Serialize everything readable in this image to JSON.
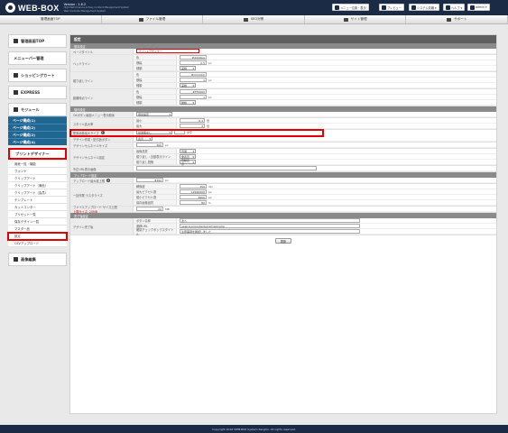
{
  "app": {
    "logo_text": "WEB-BOX",
    "version": "Version : 1.6.2",
    "tagline_1": "High Performance & Easy Content Management System",
    "tagline_2": "Web Contents Management System"
  },
  "topbar": {
    "buttons": [
      {
        "label": "メニュー位置・表示",
        "icon": "layout-icon"
      },
      {
        "label": "プレビュー",
        "icon": "monitor-icon"
      },
      {
        "label": "システム情報 ▾",
        "icon": "gear-icon"
      },
      {
        "label": "ヘルプ ▾",
        "icon": "help-icon"
      },
      {
        "label": "admin ▾",
        "icon": "user-icon"
      }
    ]
  },
  "navbar": {
    "items": [
      {
        "label": "管理画面TOP",
        "icon": "home-icon"
      },
      {
        "label": "ファイル管理",
        "icon": "image-icon"
      },
      {
        "label": "SEO対策",
        "icon": "chart-icon"
      },
      {
        "label": "サイト管理",
        "icon": "site-icon"
      },
      {
        "label": "サポート",
        "icon": "support-icon"
      }
    ]
  },
  "sidebar": {
    "top_items": [
      {
        "label": "管理画面TOP",
        "icon": "home-icon"
      },
      {
        "label": "メニューバー管理",
        "icon": ""
      },
      {
        "label": "ショッピングカート",
        "icon": "cart-icon"
      },
      {
        "label": "EXPRESS",
        "icon": "printer-icon"
      }
    ],
    "module_label": "モジュール",
    "module_icon": "gear-icon",
    "page_items": [
      "ページ構成(1)",
      "ページ構成(2)",
      "ページ構成(2)",
      "ページ構成(4)"
    ],
    "designer_label": "プリントデザイナー",
    "designer_icon": "pencil-icon",
    "sub_items": [
      "用紙一覧・機能",
      "フォント",
      "クリップアート",
      "クリップアート（満色）",
      "クリップアート（会員）",
      "テンプレート",
      "カットコンター",
      "プリセット一覧",
      "保存デザイン一覧",
      "マスター品",
      "設定",
      "CSVアップロード"
    ],
    "highlight_index": 10,
    "bottom_label": "画像編集",
    "bottom_icon": "edit-icon"
  },
  "main": {
    "title": "設定",
    "sections": [
      {
        "title": "基本設定",
        "rows": [
          {
            "label": "ページタイトル",
            "subs": [
              {
                "sub": "",
                "value": "プリントデザイナー",
                "kind": "input-red",
                "w": 70
              }
            ]
          },
          {
            "label": "ヘッドライン",
            "subs": [
              {
                "sub": "色",
                "value": "#4444AA",
                "kind": "input",
                "w": 30
              },
              {
                "sub": "横幅",
                "value": "0.5",
                "unit": "px",
                "kind": "input",
                "w": 30
              },
              {
                "sub": "種類",
                "value": "実線",
                "kind": "select",
                "w": 18
              }
            ]
          },
          {
            "label": "縦り返しライン",
            "subs": [
              {
                "sub": "色",
                "value": "#CCCCCC",
                "kind": "input",
                "w": 30
              },
              {
                "sub": "横幅",
                "value": "1",
                "unit": "px",
                "kind": "input",
                "w": 30
              },
              {
                "sub": "種類",
                "value": "実線",
                "kind": "select",
                "w": 18
              }
            ]
          },
          {
            "label": "距離時点ライン",
            "subs": [
              {
                "sub": "色",
                "value": "#FF0000",
                "kind": "input",
                "w": 30
              },
              {
                "sub": "横幅",
                "value": "1",
                "unit": "px",
                "kind": "input",
                "w": 30
              },
              {
                "sub": "種類",
                "value": "破線",
                "kind": "select",
                "w": 18
              }
            ]
          }
        ]
      },
      {
        "title": "操作設定",
        "rows": [
          {
            "label": "OKボタン画面メニュー表示順序",
            "subs": [
              {
                "sub": "",
                "value": "用途設定",
                "kind": "select",
                "w": 40
              }
            ]
          },
          {
            "label": "スタイル拡大率",
            "subs": [
              {
                "sub": "最小",
                "value": "0.1",
                "unit": "倍",
                "kind": "input",
                "w": 28
              },
              {
                "sub": "最大",
                "value": "3",
                "unit": "倍",
                "kind": "input",
                "w": 28
              }
            ]
          },
          {
            "label": "配置画像最大サイズ",
            "help": true,
            "highlight": true,
            "subs": [
              {
                "sub": "",
                "value": "最適値なし",
                "unit": "文字",
                "kind": "select",
                "w": 40,
                "extra": true
              }
            ]
          },
          {
            "label": "デザイン作成・貼付品ボタン",
            "subs": [
              {
                "sub": "",
                "value": "表示",
                "kind": "select",
                "w": 18
              }
            ]
          },
          {
            "label": "デザインサムネイルサイズ",
            "subs": [
              {
                "sub": "",
                "value": "300",
                "unit": "px",
                "kind": "input",
                "w": 30
              }
            ]
          },
          {
            "label": "デザインサムネイル設定",
            "subs": [
              {
                "sub": "画像品質",
                "value": "普通",
                "kind": "select",
                "w": 18
              },
              {
                "sub": "縦り返し・自動表示ライン",
                "value": "非表示",
                "kind": "select",
                "w": 18
              },
              {
                "sub": "縦り返し間隔",
                "value": "自動表示",
                "kind": "select",
                "w": 18
              }
            ]
          },
          {
            "label": "不正URL表示画像",
            "subs": [
              {
                "sub": "",
                "value": "",
                "kind": "input-wide",
                "w": 200
              }
            ]
          }
        ]
      },
      {
        "title": "アップロード設定",
        "rows": [
          {
            "label": "アップロード最大枚上限",
            "help": true,
            "subs": [
              {
                "sub": "",
                "value": "8192",
                "unit": "px",
                "kind": "input",
                "w": 30
              }
            ]
          },
          {
            "label": "一括作業 ラスタライズ",
            "subs": [
              {
                "sub": "解像度",
                "value": "150",
                "unit": "dpi",
                "kind": "input",
                "w": 30
              },
              {
                "sub": "最大ピクセル数",
                "value": "12960000",
                "unit": "px",
                "kind": "input",
                "w": 30
              },
              {
                "sub": "縦小ピクセル数",
                "value": "3600",
                "unit": "px",
                "kind": "input",
                "w": 30
              },
              {
                "sub": "保存画像品質",
                "value": "80",
                "unit": "%",
                "kind": "input",
                "w": 30
              }
            ]
          },
          {
            "label": "ファイルアップロード サイズ上限",
            "sublabel": "上限サイズ: 20MB",
            "subs": [
              {
                "sub": "",
                "value": "20",
                "unit": "MB",
                "kind": "input",
                "w": 30
              }
            ]
          }
        ]
      },
      {
        "title": "完了後設定",
        "rows": [
          {
            "label": "デザイン完了後",
            "subs": [
              {
                "sub": "ボタン名称",
                "value": "次へ",
                "kind": "input-wide",
                "w": 200
              },
              {
                "sub": "遷移URL",
                "value": "/web-box/contents/cart/add.php",
                "kind": "input-wide",
                "w": 200
              },
              {
                "sub": "確認チェックボックスタイトル",
                "value": "注意事項を確認しました",
                "kind": "input-wide",
                "w": 200
              }
            ]
          }
        ]
      }
    ],
    "submit_label": "更新"
  },
  "footer": {
    "text": "Copyright 2016 WEB-BOX System Sangho. All rights reserved."
  },
  "colors": {
    "topbar": "#1b2b45",
    "sidebar_category": "#1f6691",
    "highlight": "#e00000",
    "header": "#5f5f5f"
  }
}
